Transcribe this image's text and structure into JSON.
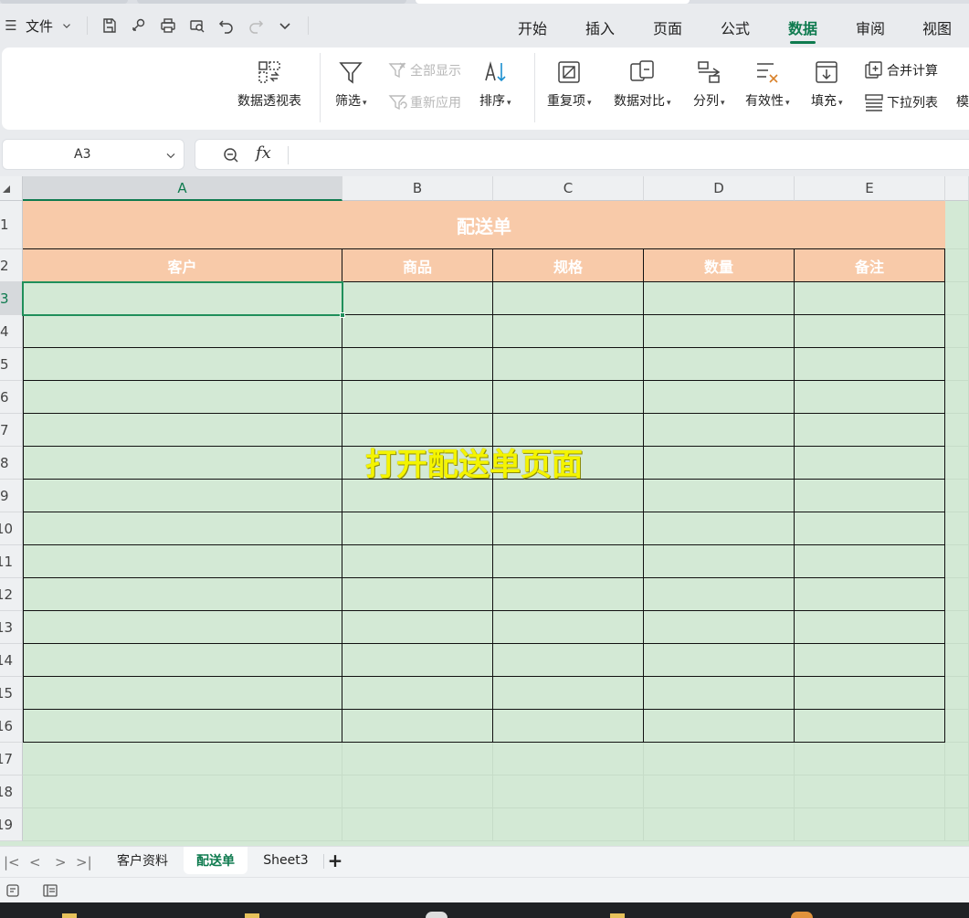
{
  "menu": {
    "file_label": "文件",
    "tabs": [
      "开始",
      "插入",
      "页面",
      "公式",
      "数据",
      "审阅",
      "视图"
    ],
    "active_tab": "数据"
  },
  "ribbon": {
    "pivot": "数据透视表",
    "filter": "筛选",
    "show_all": "全部显示",
    "reapply": "重新应用",
    "sort": "排序",
    "duplicates": "重复项",
    "compare": "数据对比",
    "split": "分列",
    "validity": "有效性",
    "fill": "填充",
    "consolidate": "合并计算",
    "dropdown_list": "下拉列表",
    "more": "模"
  },
  "formula_bar": {
    "name_box": "A3",
    "fx": "fx",
    "content": ""
  },
  "sheet": {
    "columns": [
      "A",
      "B",
      "C",
      "D",
      "E"
    ],
    "rows": [
      "1",
      "2",
      "3",
      "4",
      "5",
      "6",
      "7",
      "8",
      "9",
      "10",
      "11",
      "12",
      "13",
      "14",
      "15",
      "16",
      "17",
      "18",
      "19"
    ],
    "title": "配送单",
    "headers": [
      "客户",
      "商品",
      "规格",
      "数量",
      "备注"
    ],
    "selected_cell": "A3",
    "overlay_caption": "打开配送单页面"
  },
  "sheet_tabs": {
    "tabs": [
      "客户资料",
      "配送单",
      "Sheet3"
    ],
    "active": "配送单",
    "add": "+"
  },
  "colors": {
    "accent": "#0f7b4f",
    "header_fill": "#f8caa9",
    "cell_fill": "#d3e9d5",
    "overlay_text": "#f4f400"
  }
}
